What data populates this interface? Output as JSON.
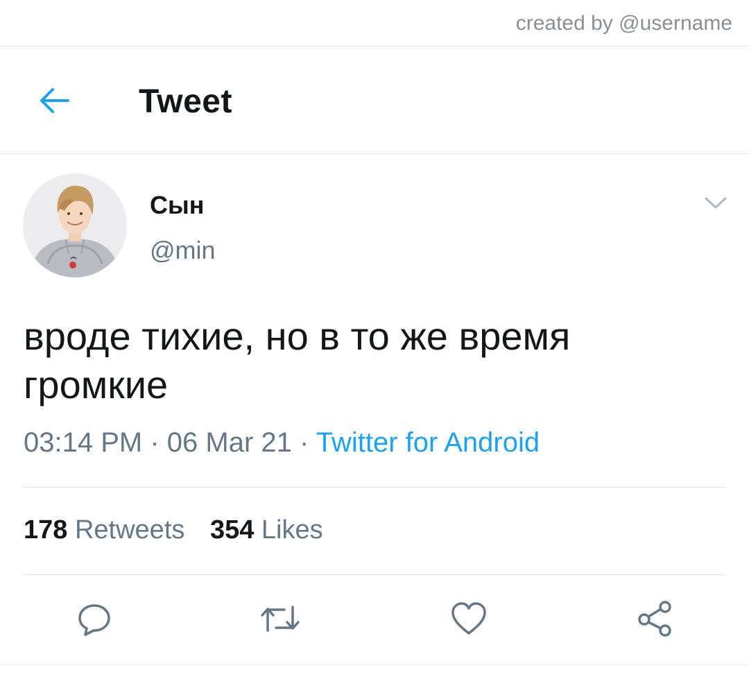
{
  "credit": "created by @username",
  "header": {
    "title": "Tweet",
    "back_icon": "arrow-left-icon"
  },
  "author": {
    "display_name": "Сын",
    "handle": "@min"
  },
  "tweet": {
    "text_line1": "вроде тихие, но в то же время",
    "text_line2": "громкие",
    "time": "03:14 PM",
    "separator": "·",
    "date": "06 Mar 21",
    "source": "Twitter for Android"
  },
  "stats": {
    "retweets_count": "178",
    "retweets_label": "Retweets",
    "likes_count": "354",
    "likes_label": "Likes"
  },
  "actions": [
    "reply-icon",
    "retweet-icon",
    "like-icon",
    "share-icon"
  ],
  "colors": {
    "accent": "#1da1f2",
    "text_primary": "#14171a",
    "text_secondary": "#657786",
    "icon_gray": "#657786",
    "divider": "#e1e4e7"
  }
}
